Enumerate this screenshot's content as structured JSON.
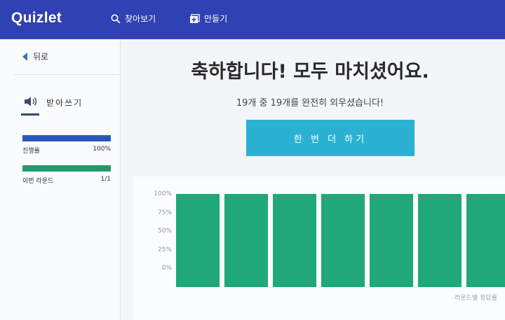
{
  "header": {
    "logo": "Quizlet",
    "search_label": "찾아보기",
    "create_label": "만들기"
  },
  "sidebar": {
    "back_label": "뒤로",
    "mode_label": "받아쓰기",
    "progress": [
      {
        "label": "진행률",
        "value_text": "100%",
        "fraction": 1.0,
        "color": "#2b58b8"
      },
      {
        "label": "이번 라운드",
        "value_text": "1/1",
        "fraction": 1.0,
        "color": "#239a6e"
      }
    ]
  },
  "main": {
    "title": "축하합니다! 모두 마치셨어요.",
    "subtitle": "19개 중 19개를 완전히 외우셨습니다!",
    "again_button": "한 번 더 하기"
  },
  "chart_data": {
    "type": "bar",
    "y_tick_labels": [
      "100%",
      "75%",
      "50%",
      "25%",
      "0%"
    ],
    "ylim": [
      0,
      100
    ],
    "values": [
      100,
      100,
      100,
      100,
      100,
      100,
      100
    ],
    "caption": "라운드별 정답률",
    "bar_color": "#20a77a"
  },
  "colors": {
    "header_bg": "#2f41b3",
    "button_bg": "#2bb2d3",
    "accent_green": "#20a77a"
  }
}
